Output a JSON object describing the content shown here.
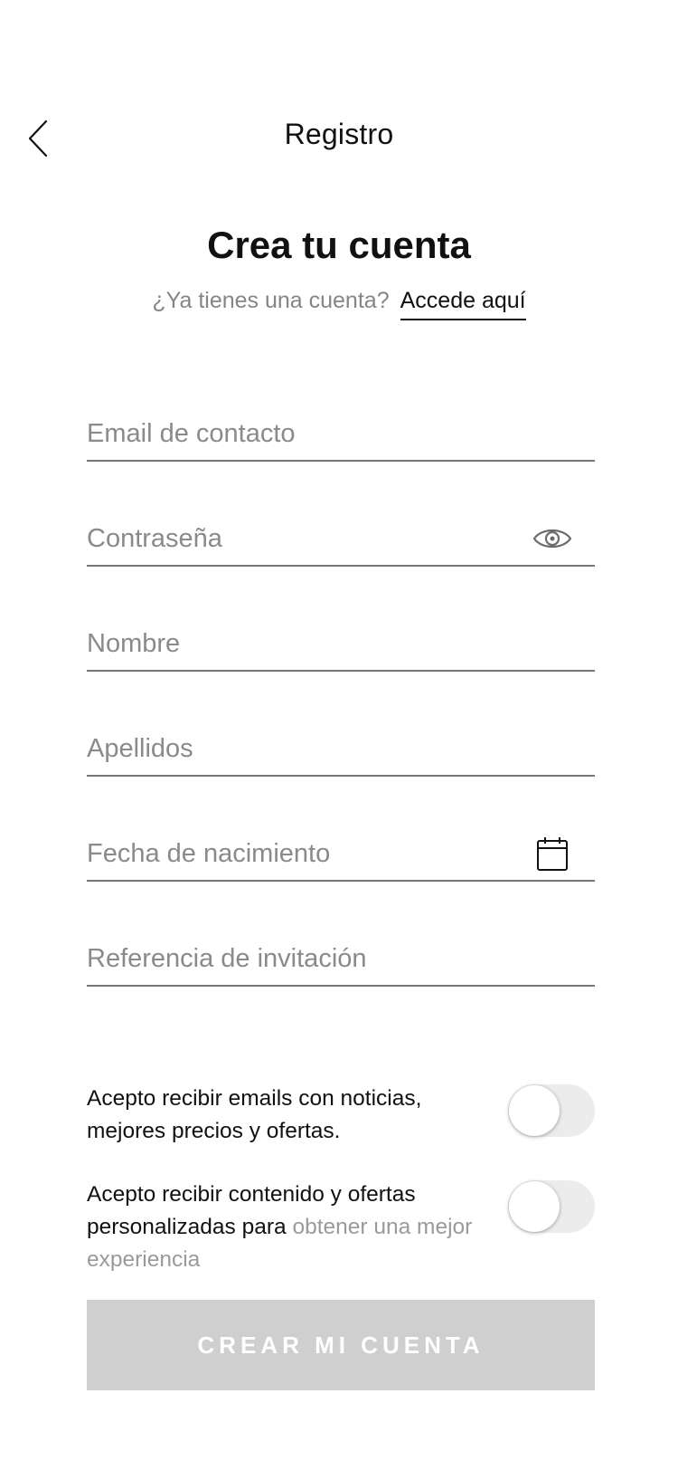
{
  "header": {
    "back_icon": "chevron-left-icon",
    "title": "Registro"
  },
  "hero": {
    "heading": "Crea tu cuenta",
    "question": "¿Ya tienes una cuenta?",
    "login_link": "Accede aquí"
  },
  "form": {
    "email": {
      "placeholder": "Email de contacto",
      "value": ""
    },
    "password": {
      "placeholder": "Contraseña",
      "value": "",
      "icon": "eye-icon"
    },
    "first_name": {
      "placeholder": "Nombre",
      "value": ""
    },
    "last_name": {
      "placeholder": "Apellidos",
      "value": ""
    },
    "birth_date": {
      "placeholder": "Fecha de nacimiento",
      "value": "",
      "icon": "calendar-icon"
    },
    "invite_reference": {
      "placeholder": "Referencia de invitación",
      "value": ""
    }
  },
  "consents": [
    {
      "text": "Acepto recibir emails con noticias, mejores precios y ofertas.",
      "enabled": false
    },
    {
      "text": "Acepto recibir contenido y ofertas personalizadas para",
      "text_faded": "obtener una mejor experiencia",
      "enabled": false
    }
  ],
  "submit": {
    "label": "CREAR MI CUENTA"
  },
  "colors": {
    "text": "#111111",
    "placeholder": "#8a8a8a",
    "divider": "#777777",
    "button_disabled": "#cfcfcf",
    "toggle_track": "#ececec"
  }
}
